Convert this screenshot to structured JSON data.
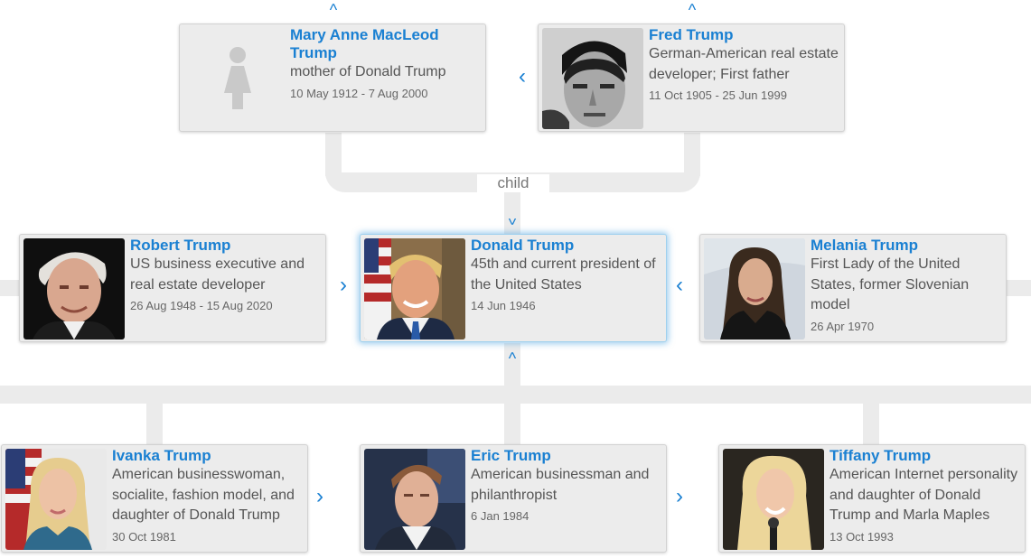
{
  "relation_label": "child",
  "chevrons": {
    "up": "^",
    "down": "^",
    "left": "‹",
    "right": "›"
  },
  "parents": [
    {
      "name": "Mary Anne MacLeod Trump",
      "description": "mother of Donald Trump",
      "dates": "10 May 1912 - 7 Aug 2000",
      "photo": "female-placeholder-icon"
    },
    {
      "name": "Fred Trump",
      "description": "German-American real estate developer; First father",
      "dates": "11 Oct 1905 - 25 Jun 1999",
      "photo": "portrait-photo"
    }
  ],
  "siblings": [
    {
      "name": "Robert Trump",
      "description": "US business executive and real estate developer",
      "dates": "26 Aug 1948 - 15 Aug 2020"
    }
  ],
  "focus": {
    "name": "Donald Trump",
    "description": "45th and current president of the United States",
    "dates": "14 Jun 1946"
  },
  "spouses": [
    {
      "name": "Melania Trump",
      "description": "First Lady of the United States, former Slovenian model",
      "dates": "26 Apr 1970"
    }
  ],
  "children": [
    {
      "name": "Ivanka Trump",
      "description": "American businesswoman, socialite, fashion model, and daughter of Donald Trump",
      "dates": "30 Oct 1981"
    },
    {
      "name": "Eric Trump",
      "description": "American businessman and philanthropist",
      "dates": "6 Jan 1984"
    },
    {
      "name": "Tiffany Trump",
      "description": "American Internet personality and daughter of Donald Trump and Marla Maples",
      "dates": "13 Oct 1993"
    }
  ],
  "colors": {
    "link": "#1a80d2",
    "card_bg": "#ececec",
    "connector": "#ebebeb",
    "focus_glow": "#9ed0ee"
  }
}
